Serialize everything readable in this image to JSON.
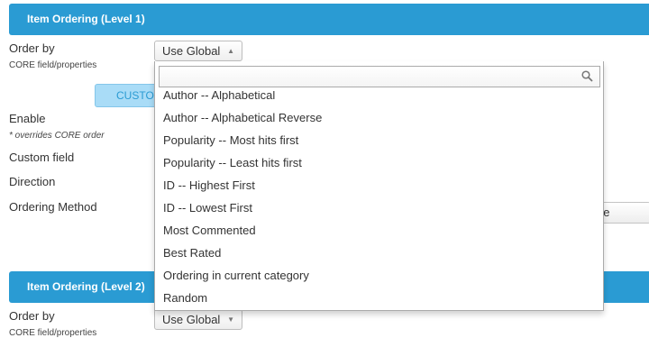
{
  "section1": {
    "title": "Item Ordering (Level 1)",
    "order_by_label": "Order by",
    "order_by_sub": "CORE field/properties",
    "order_by_value": "Use Global",
    "custom_button_label": "CUSTOM",
    "enable_label": "Enable",
    "enable_sub": "* overrides CORE order",
    "custom_field_label": "Custom field",
    "direction_label": "Direction",
    "ordering_method_label": "Ordering Method",
    "partial_button_label": "Date"
  },
  "section2": {
    "title": "Item Ordering (Level 2)",
    "order_by_label": "Order by",
    "order_by_sub": "CORE field/properties",
    "order_by_value": "Use Global"
  },
  "dropdown": {
    "search_value": "",
    "options": [
      "Author -- Alphabetical",
      "Author -- Alphabetical Reverse",
      "Popularity -- Most hits first",
      "Popularity -- Least hits first",
      "ID -- Highest First",
      "ID -- Lowest First",
      "Most Commented",
      "Best Rated",
      "Ordering in current category",
      "Random"
    ]
  },
  "colors": {
    "header_bg": "#2a9bd3",
    "custom_button_bg": "#a9dcf7"
  },
  "icons": {
    "search": "search-icon",
    "select_arrow_open": "triangle-up-icon",
    "select_arrow_closed": "triangle-down-icon"
  }
}
